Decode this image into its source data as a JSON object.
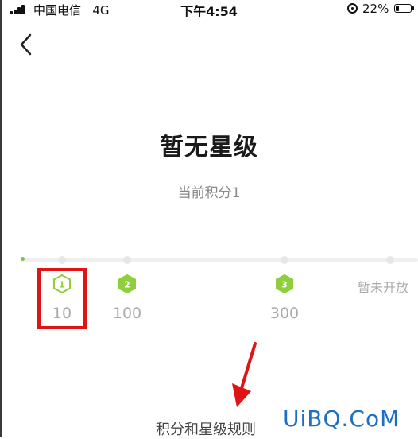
{
  "status_bar": {
    "carrier": "中国电信",
    "network": "4G",
    "time": "下午4:54",
    "battery_percent": "22%",
    "battery_level": 0.22
  },
  "header": {
    "back_icon": "chevron-left-icon"
  },
  "page": {
    "title": "暂无星级",
    "current_points": "当前积分1"
  },
  "levels": [
    {
      "badge": "1",
      "value": "10",
      "style": "outline"
    },
    {
      "badge": "2",
      "value": "100",
      "style": "filled"
    },
    {
      "badge": "3",
      "value": "300",
      "style": "filled"
    }
  ],
  "closed_label": "暂未开放",
  "rules_link": "积分和星级规则",
  "watermark": "UiBQ.CoM",
  "colors": {
    "accent": "#7cc24a",
    "highlight": "#e01414",
    "watermark": "#1e6fc0"
  }
}
